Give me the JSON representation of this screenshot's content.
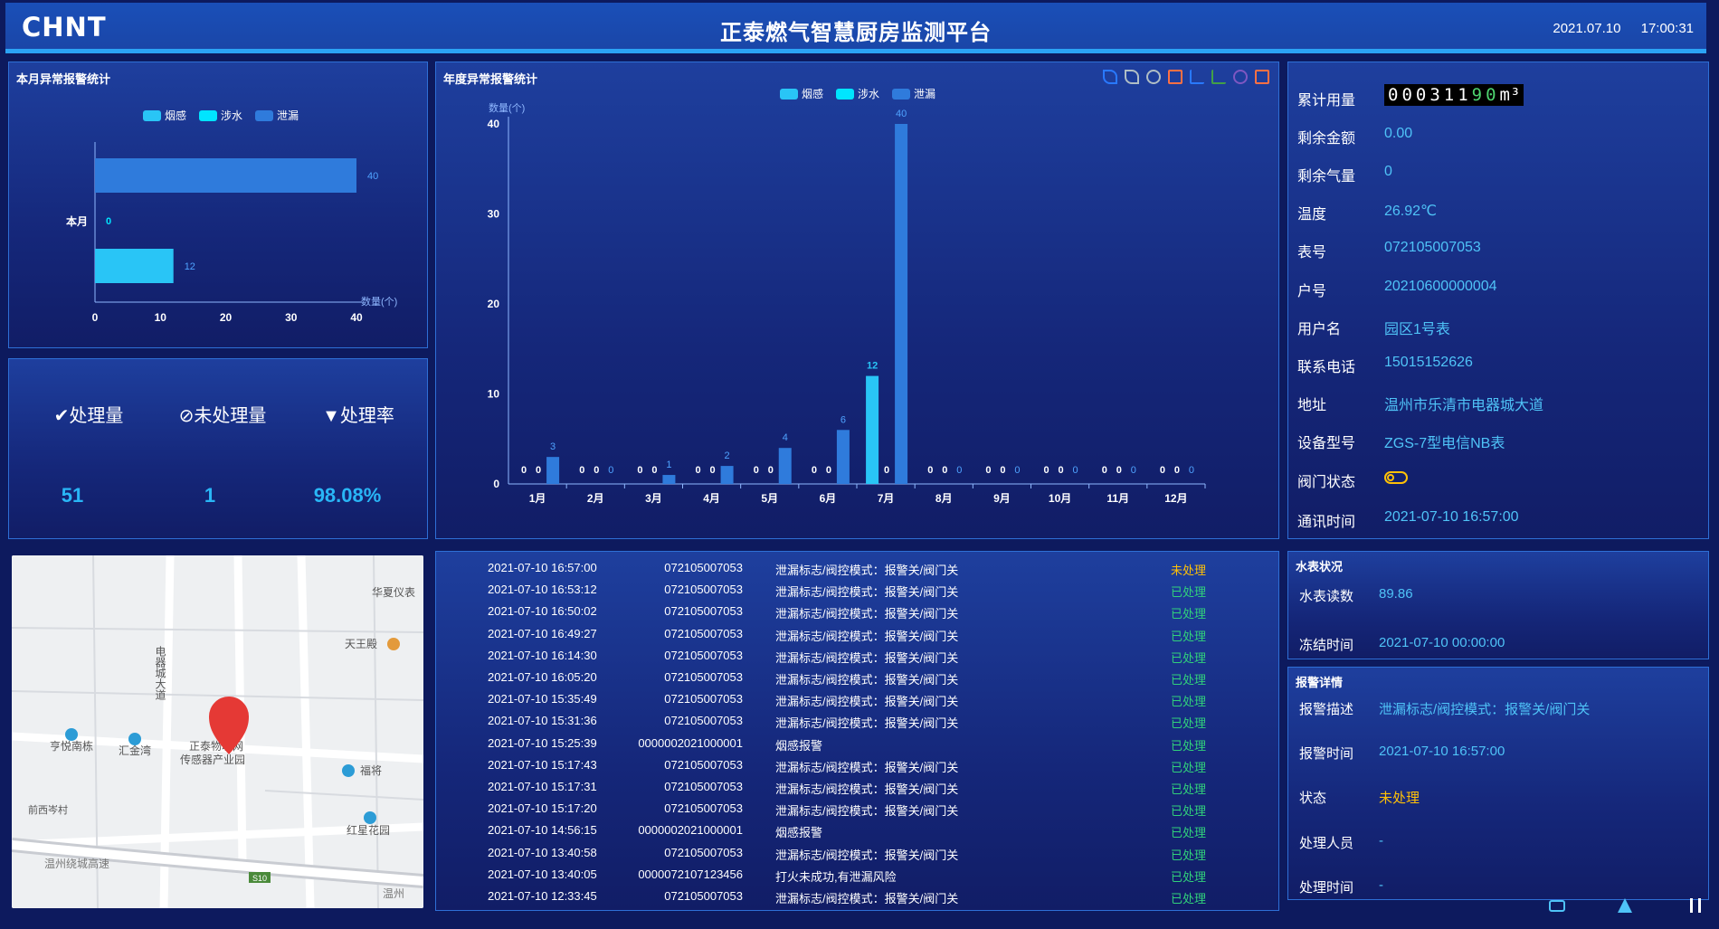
{
  "header": {
    "logo": "CHNT",
    "title": "正泰燃气智慧厨房监测平台",
    "date": "2021.07.10",
    "time": "17:00:31"
  },
  "monthly_panel": {
    "title": "本月异常报警统计",
    "legend": [
      {
        "name": "烟感",
        "color": "#29b6f6"
      },
      {
        "name": "涉水",
        "color": "#00e5ff"
      },
      {
        "name": "泄漏",
        "color": "#2979ff"
      }
    ]
  },
  "stats": {
    "processed_label": "处理量",
    "unprocessed_label": "未处理量",
    "rate_label": "处理率",
    "processed_value": "51",
    "unprocessed_value": "1",
    "rate_value": "98.08%"
  },
  "yearly_panel": {
    "title": "年度异常报警统计",
    "legend": [
      {
        "name": "烟感",
        "color": "#29b6f6"
      },
      {
        "name": "涉水",
        "color": "#00e5ff"
      },
      {
        "name": "泄漏",
        "color": "#2979ff"
      }
    ],
    "toolbox_icons": [
      "pencil-icon",
      "pen-icon",
      "reset-icon",
      "data-view-icon",
      "line-chart-icon",
      "bar-chart-icon",
      "refresh-icon",
      "save-icon"
    ]
  },
  "chart_data": [
    {
      "type": "bar",
      "orientation": "horizontal",
      "categories": [
        "本月"
      ],
      "series": [
        {
          "name": "烟感",
          "values": [
            12
          ],
          "color": "#29c5f6"
        },
        {
          "name": "涉水",
          "values": [
            0
          ],
          "color": "#00e5ff"
        },
        {
          "name": "泄漏",
          "values": [
            40
          ],
          "color": "#2f7bdc"
        }
      ],
      "xlabel": "数量(个)",
      "xlim": [
        0,
        40
      ],
      "xticks": [
        0,
        10,
        20,
        30,
        40
      ],
      "legend": "top-center"
    },
    {
      "type": "bar",
      "categories": [
        "1月",
        "2月",
        "3月",
        "4月",
        "5月",
        "6月",
        "7月",
        "8月",
        "9月",
        "10月",
        "11月",
        "12月"
      ],
      "series": [
        {
          "name": "烟感",
          "values": [
            0,
            0,
            0,
            0,
            0,
            0,
            12,
            0,
            0,
            0,
            0,
            0
          ],
          "color": "#29c5f6"
        },
        {
          "name": "涉水",
          "values": [
            0,
            0,
            0,
            0,
            0,
            0,
            0,
            0,
            0,
            0,
            0,
            0
          ],
          "color": "#00e5ff"
        },
        {
          "name": "泄漏",
          "values": [
            3,
            0,
            1,
            2,
            4,
            6,
            40,
            0,
            0,
            0,
            0,
            0
          ],
          "color": "#2f7bdc"
        }
      ],
      "ylabel": "数量(个)",
      "ylim": [
        0,
        40
      ],
      "yticks": [
        0,
        10,
        20,
        30,
        40
      ],
      "legend": "top-center"
    }
  ],
  "meter_info": {
    "rows": [
      {
        "label": "累计用量",
        "value": "00031190",
        "unit": "m³",
        "type": "meter"
      },
      {
        "label": "剩余金额",
        "value": "0.00"
      },
      {
        "label": "剩余气量",
        "value": "0"
      },
      {
        "label": "温度",
        "value": "26.92℃"
      },
      {
        "label": "表号",
        "value": "072105007053"
      },
      {
        "label": "户号",
        "value": "20210600000004"
      },
      {
        "label": "用户名",
        "value": "园区1号表"
      },
      {
        "label": "联系电话",
        "value": "15015152626"
      },
      {
        "label": "地址",
        "value": "温州市乐清市电器城大道"
      },
      {
        "label": "设备型号",
        "value": "ZGS-7型电信NB表"
      },
      {
        "label": "阀门状态",
        "value": "",
        "type": "valve"
      },
      {
        "label": "通讯时间",
        "value": "2021-07-10 16:57:00"
      }
    ],
    "valve_color": "#ffc107"
  },
  "map": {
    "labels": [
      "华夏仪表",
      "天王殿",
      "电器城大道",
      "亨悦南栋",
      "汇金湾",
      "正泰物联网",
      "传感器产业园",
      "福将",
      "前西岑村",
      "红星花园",
      "温州绕城高速",
      "S10",
      "温州"
    ]
  },
  "alarm_log": {
    "rows": [
      {
        "time": "2021-07-10 16:57:00",
        "device": "072105007053",
        "desc": "泄漏标志/阀控模式：报警关/阀门关",
        "status": "未处理",
        "pending": true
      },
      {
        "time": "2021-07-10 16:53:12",
        "device": "072105007053",
        "desc": "泄漏标志/阀控模式：报警关/阀门关",
        "status": "已处理",
        "pending": false
      },
      {
        "time": "2021-07-10 16:50:02",
        "device": "072105007053",
        "desc": "泄漏标志/阀控模式：报警关/阀门关",
        "status": "已处理",
        "pending": false
      },
      {
        "time": "2021-07-10 16:49:27",
        "device": "072105007053",
        "desc": "泄漏标志/阀控模式：报警关/阀门关",
        "status": "已处理",
        "pending": false
      },
      {
        "time": "2021-07-10 16:14:30",
        "device": "072105007053",
        "desc": "泄漏标志/阀控模式：报警关/阀门关",
        "status": "已处理",
        "pending": false
      },
      {
        "time": "2021-07-10 16:05:20",
        "device": "072105007053",
        "desc": "泄漏标志/阀控模式：报警关/阀门关",
        "status": "已处理",
        "pending": false
      },
      {
        "time": "2021-07-10 15:35:49",
        "device": "072105007053",
        "desc": "泄漏标志/阀控模式：报警关/阀门关",
        "status": "已处理",
        "pending": false
      },
      {
        "time": "2021-07-10 15:31:36",
        "device": "072105007053",
        "desc": "泄漏标志/阀控模式：报警关/阀门关",
        "status": "已处理",
        "pending": false
      },
      {
        "time": "2021-07-10 15:25:39",
        "device": "0000002021000001",
        "desc": "烟感报警",
        "status": "已处理",
        "pending": false
      },
      {
        "time": "2021-07-10 15:17:43",
        "device": "072105007053",
        "desc": "泄漏标志/阀控模式：报警关/阀门关",
        "status": "已处理",
        "pending": false
      },
      {
        "time": "2021-07-10 15:17:31",
        "device": "072105007053",
        "desc": "泄漏标志/阀控模式：报警关/阀门关",
        "status": "已处理",
        "pending": false
      },
      {
        "time": "2021-07-10 15:17:20",
        "device": "072105007053",
        "desc": "泄漏标志/阀控模式：报警关/阀门关",
        "status": "已处理",
        "pending": false
      },
      {
        "time": "2021-07-10 14:56:15",
        "device": "0000002021000001",
        "desc": "烟感报警",
        "status": "已处理",
        "pending": false
      },
      {
        "time": "2021-07-10 13:40:58",
        "device": "072105007053",
        "desc": "泄漏标志/阀控模式：报警关/阀门关",
        "status": "已处理",
        "pending": false
      },
      {
        "time": "2021-07-10 13:40:05",
        "device": "0000072107123456",
        "desc": "打火未成功,有泄漏风险",
        "status": "已处理",
        "pending": false
      },
      {
        "time": "2021-07-10 12:33:45",
        "device": "072105007053",
        "desc": "泄漏标志/阀控模式：报警关/阀门关",
        "status": "已处理",
        "pending": false
      }
    ]
  },
  "water_meter": {
    "title": "水表状况",
    "reading_label": "水表读数",
    "reading_value": "89.86",
    "freeze_label": "冻结时间",
    "freeze_value": "2021-07-10 00:00:00"
  },
  "alarm_detail": {
    "title": "报警详情",
    "desc_label": "报警描述",
    "desc_value": "泄漏标志/阀控模式：报警关/阀门关",
    "time_label": "报警时间",
    "time_value": "2021-07-10 16:57:00",
    "status_label": "状态",
    "status_value": "未处理",
    "handler_label": "处理人员",
    "handler_value": "-",
    "handle_time_label": "处理时间",
    "handle_time_value": "-"
  },
  "bottom_icons": [
    "cc-icon",
    "road-icon",
    "kitchen-icon"
  ]
}
